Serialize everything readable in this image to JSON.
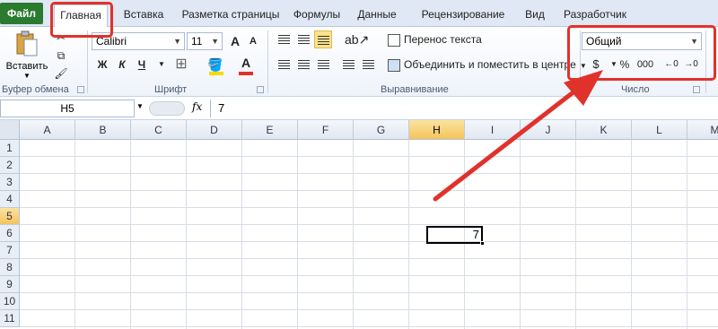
{
  "tabs": [
    "Файл",
    "Главная",
    "Вставка",
    "Разметка страницы",
    "Формулы",
    "Данные",
    "Рецензирование",
    "Вид",
    "Разработчик"
  ],
  "clipboard": {
    "paste_label": "Вставить",
    "group_label": "Буфер обмена"
  },
  "font": {
    "name": "Calibri",
    "size": "11",
    "group_label": "Шрифт",
    "bold": "Ж",
    "italic": "К",
    "underline": "Ч",
    "grow": "A",
    "shrink": "A",
    "color_letter": "A"
  },
  "alignment": {
    "wrap_text": "Перенос текста",
    "merge_center": "Объединить и поместить в центре",
    "group_label": "Выравнивание"
  },
  "number": {
    "format": "Общий",
    "group_label": "Число",
    "percent": "%",
    "thousands": "000"
  },
  "formula_bar": {
    "cell_ref": "H5",
    "fx": "fx",
    "value": "7"
  },
  "columns": [
    "A",
    "B",
    "C",
    "D",
    "E",
    "F",
    "G",
    "H",
    "I",
    "J",
    "K",
    "L",
    "M"
  ],
  "rows": [
    "1",
    "2",
    "3",
    "4",
    "5",
    "6",
    "7",
    "8",
    "9",
    "10",
    "11"
  ],
  "active_cell": {
    "ref": "H5",
    "value": "7"
  },
  "colors": {
    "file_tab": "#2a7a2f",
    "highlight": "#e0322b",
    "selected_header": "#f5c35a"
  }
}
